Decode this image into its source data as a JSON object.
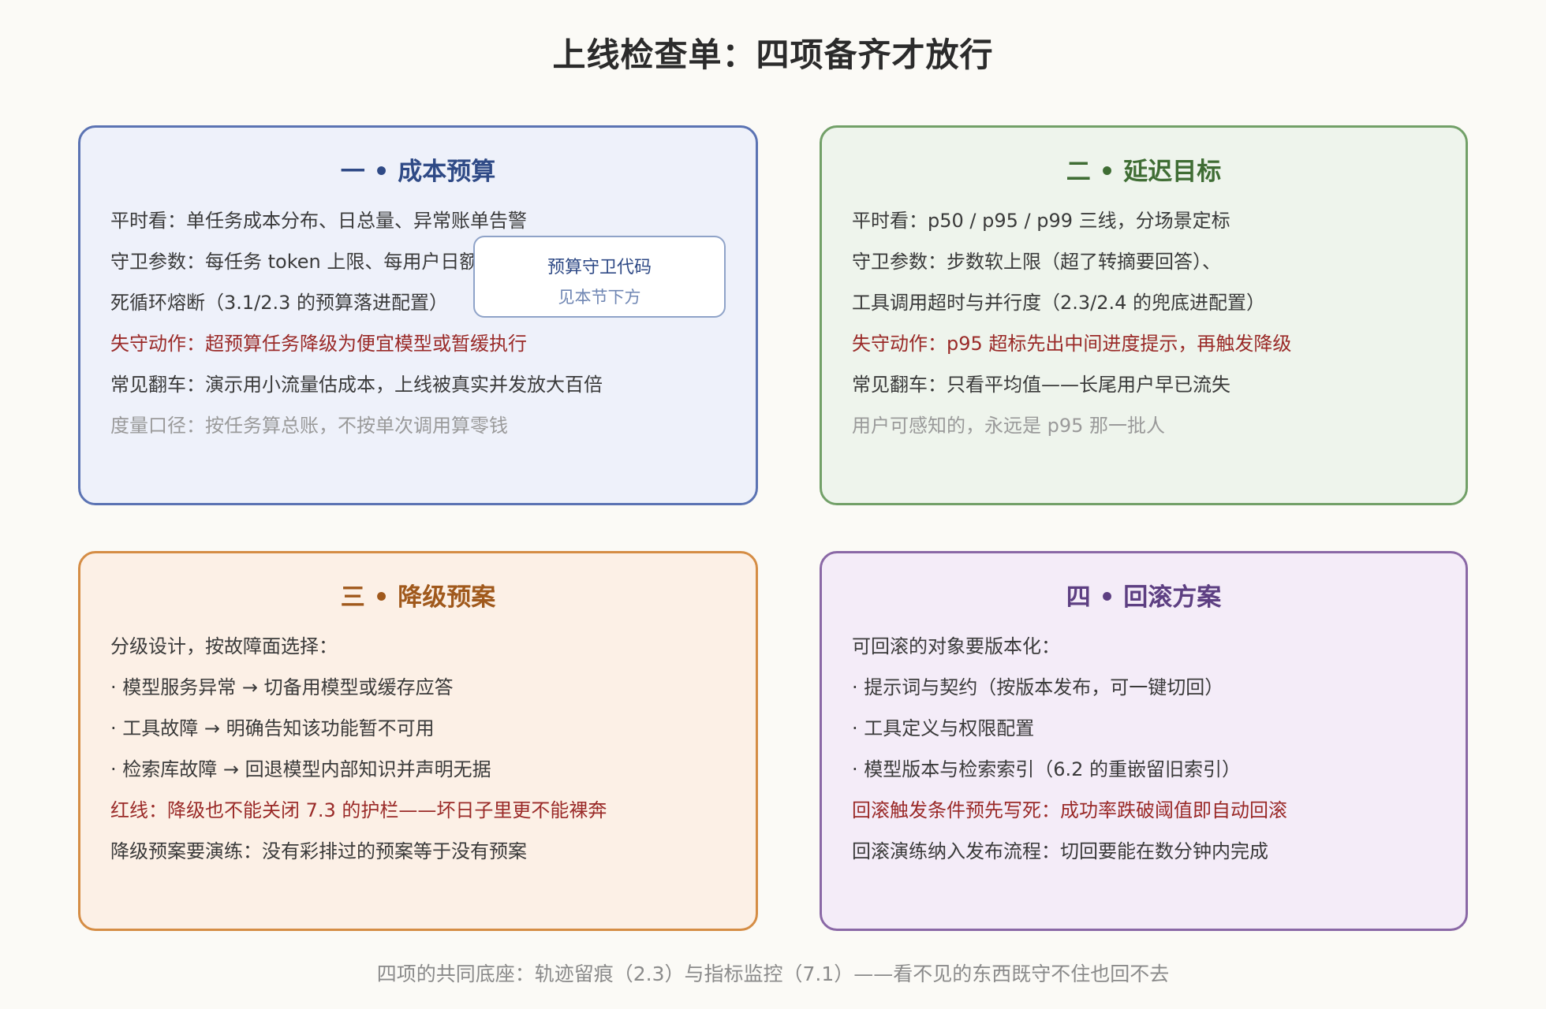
{
  "title": "上线检查单：四项备齐才放行",
  "cards": [
    {
      "title": "一 • 成本预算",
      "lines": [
        "平时看：单任务成本分布、日总量、异常账单告警",
        "守卫参数：每任务 token 上限、每用户日额度、",
        "死循环熔断（3.1/2.3 的预算落进配置）",
        "失守动作：超预算任务降级为便宜模型或暂缓执行",
        "常见翻车：演示用小流量估成本，上线被真实并发放大百倍",
        "度量口径：按任务算总账，不按单次调用算零钱"
      ],
      "callout": {
        "title": "预算守卫代码",
        "subtitle": "见本节下方"
      }
    },
    {
      "title": "二 • 延迟目标",
      "lines": [
        "平时看：p50 / p95 / p99 三线，分场景定标",
        "守卫参数：步数软上限（超了转摘要回答）、",
        "工具调用超时与并行度（2.3/2.4 的兜底进配置）",
        "失守动作：p95 超标先出中间进度提示，再触发降级",
        "常见翻车：只看平均值——长尾用户早已流失",
        "用户可感知的，永远是 p95 那一批人"
      ]
    },
    {
      "title": "三 • 降级预案",
      "lines": [
        "分级设计，按故障面选择：",
        "· 模型服务异常 → 切备用模型或缓存应答",
        "· 工具故障 → 明确告知该功能暂不可用",
        "· 检索库故障 → 回退模型内部知识并声明无据",
        "红线：降级也不能关闭 7.3 的护栏——坏日子里更不能裸奔",
        "降级预案要演练：没有彩排过的预案等于没有预案"
      ]
    },
    {
      "title": "四 • 回滚方案",
      "lines": [
        "可回滚的对象要版本化：",
        "· 提示词与契约（按版本发布，可一键切回）",
        "· 工具定义与权限配置",
        "· 模型版本与检索索引（6.2 的重嵌留旧索引）",
        "回滚触发条件预先写死：成功率跌破阈值即自动回滚",
        "回滚演练纳入发布流程：切回要能在数分钟内完成"
      ]
    }
  ],
  "footer": "四项的共同底座：轨迹留痕（2.3）与指标监控（7.1）——看不见的东西既守不住也回不去"
}
